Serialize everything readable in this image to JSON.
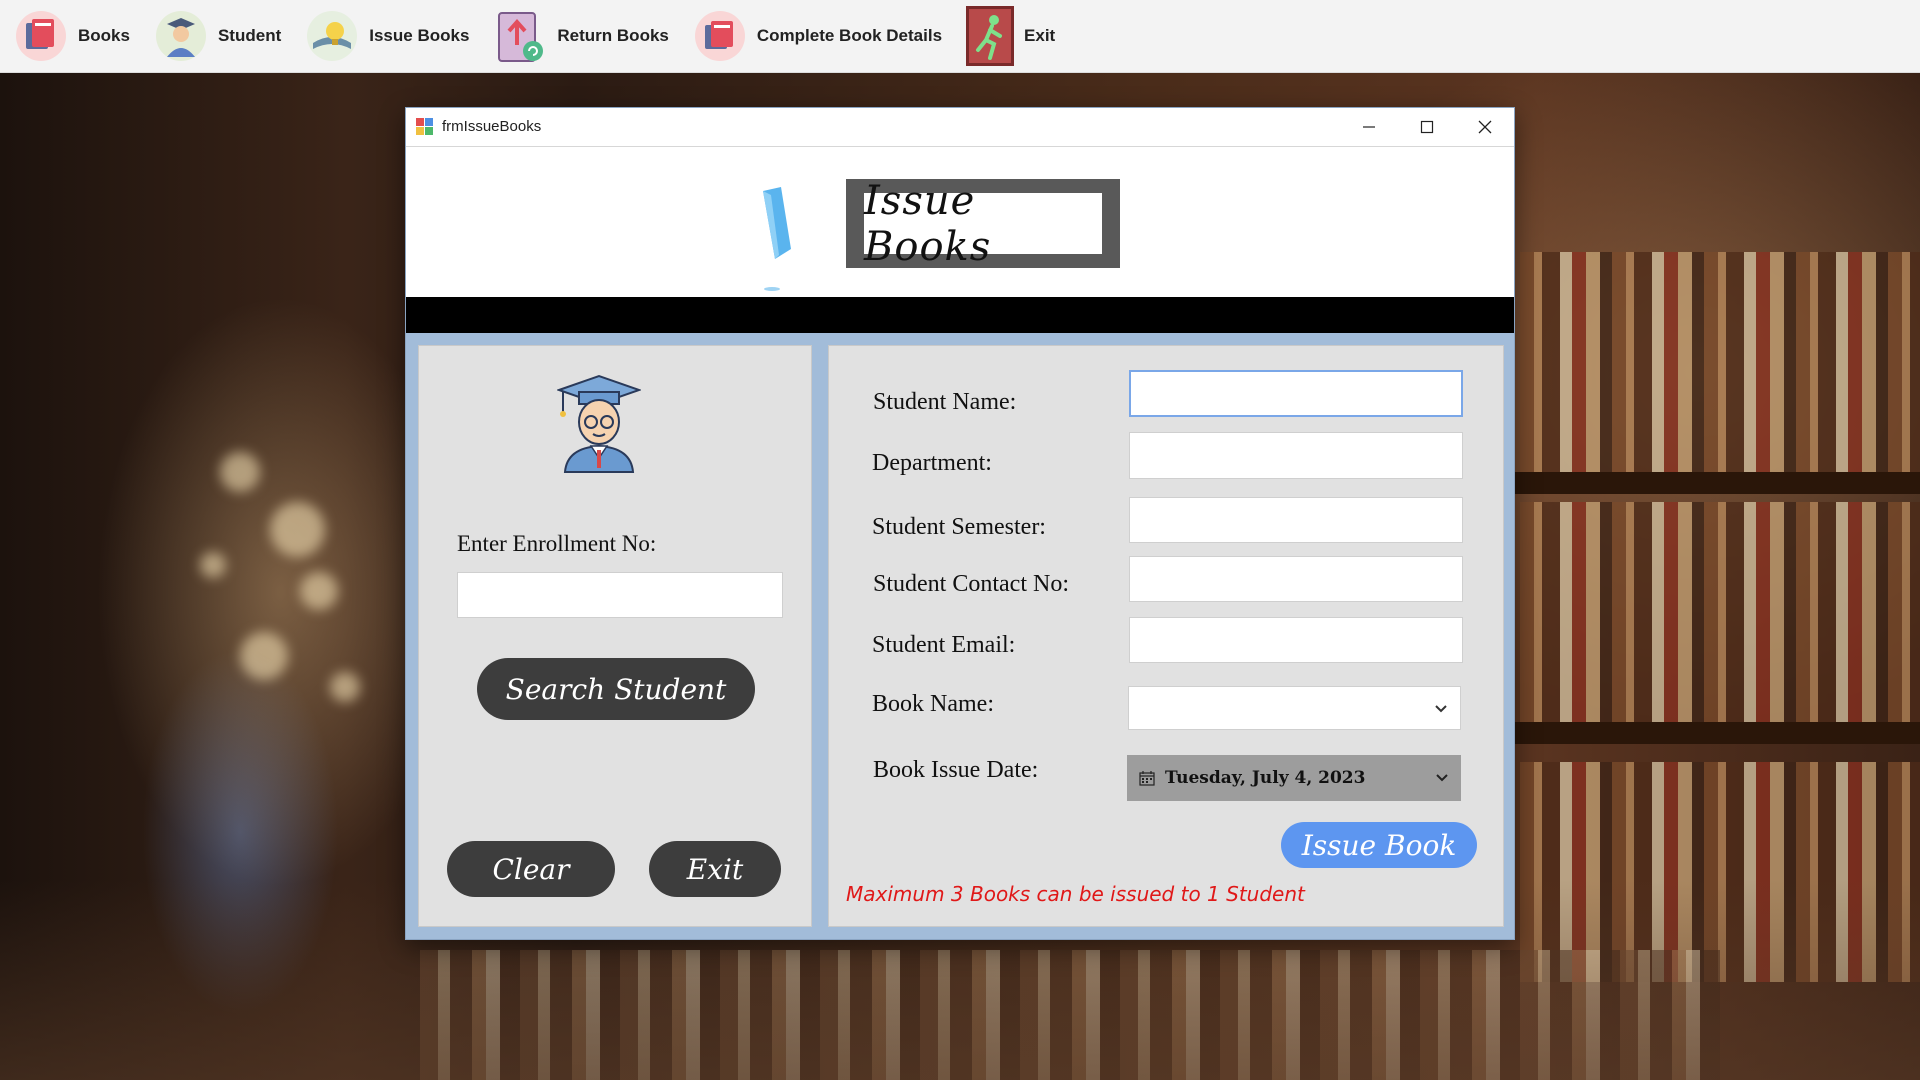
{
  "menubar": {
    "items": [
      {
        "label": "Books",
        "icon": "books-icon"
      },
      {
        "label": "Student",
        "icon": "student-icon"
      },
      {
        "label": "Issue Books",
        "icon": "issue-books-icon"
      },
      {
        "label": "Return Books",
        "icon": "return-books-icon"
      },
      {
        "label": "Complete Book Details",
        "icon": "book-details-icon"
      },
      {
        "label": "Exit",
        "icon": "exit-runner-icon"
      }
    ]
  },
  "window": {
    "title": "frmIssueBooks",
    "heading": "Issue Books"
  },
  "left_panel": {
    "enrollment_label": "Enter Enrollment No:",
    "enrollment_value": "",
    "search_button": "Search Student",
    "clear_button": "Clear",
    "exit_button": "Exit"
  },
  "form": {
    "student_name_label": "Student Name:",
    "department_label": "Department:",
    "semester_label": "Student Semester:",
    "contact_label": "Student Contact No:",
    "email_label": "Student Email:",
    "book_name_label": "Book Name:",
    "issue_date_label": "Book Issue Date:",
    "issue_date_value": "Tuesday, July 4, 2023",
    "issue_button": "Issue Book",
    "warning": "Maximum 3 Books can be issued to 1 Student"
  },
  "colors": {
    "accent_blue": "#5d96f0",
    "dark_button": "#3d3d3d",
    "warning_red": "#e01818",
    "window_frame": "#a2bcd9"
  }
}
